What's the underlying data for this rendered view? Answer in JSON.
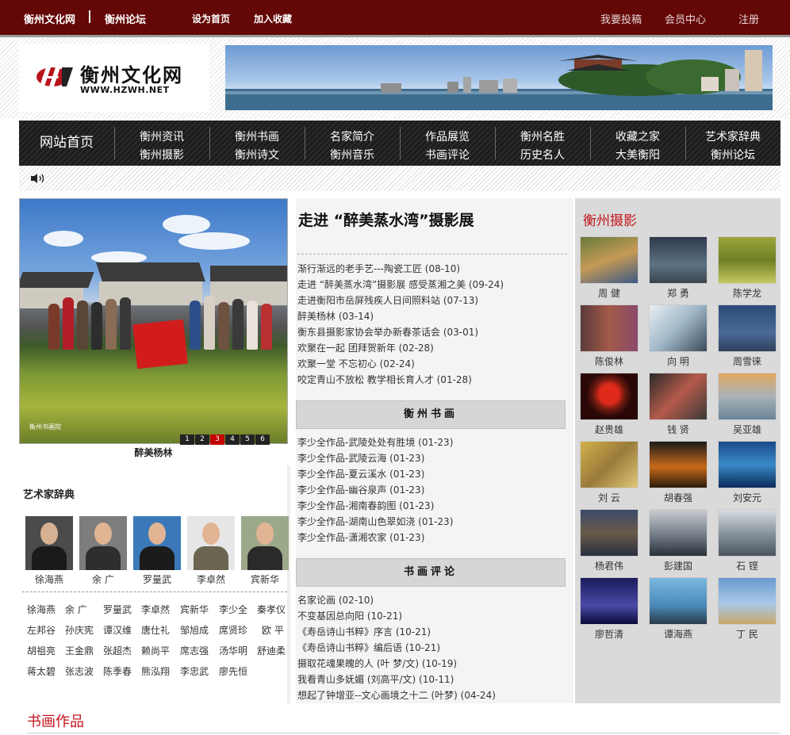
{
  "topbar": {
    "site_name": "衡州文化网",
    "forum": "衡州论坛",
    "set_home": "设为首页",
    "add_fav": "加入收藏",
    "submit": "我要投稿",
    "member": "会员中心",
    "register": "注册"
  },
  "logo": {
    "brand": "衡州文化网",
    "url": "WWW.HZWH.NET"
  },
  "nav": {
    "home": "网站首页",
    "columns": [
      {
        "a": "衡州资讯",
        "b": "衡州摄影"
      },
      {
        "a": "衡州书画",
        "b": "衡州诗文"
      },
      {
        "a": "名家简介",
        "b": "衡州音乐"
      },
      {
        "a": "作品展览",
        "b": "书画评论"
      },
      {
        "a": "衡州名胜",
        "b": "历史名人"
      },
      {
        "a": "收藏之家",
        "b": "大美衡阳"
      },
      {
        "a": "艺术家辞典",
        "b": "衡州论坛"
      }
    ]
  },
  "slideshow": {
    "caption": "醉美杨林",
    "credit": "衡州书画院",
    "pages": [
      "1",
      "2",
      "3",
      "4",
      "5",
      "6"
    ],
    "active_page": "3"
  },
  "artists": {
    "title": "艺术家辞典",
    "featured": [
      "徐海燕",
      "余 广",
      "罗量武",
      "李卓然",
      "宾新华"
    ],
    "names": [
      [
        "徐海燕",
        "余 广",
        "罗量武",
        "李卓然",
        "宾新华",
        "李少全",
        "秦孝仪"
      ],
      [
        "左邦谷",
        "孙庆宪",
        "谭汉维",
        "唐仕礼",
        "邹旭成",
        "席贤珍",
        "欧 平"
      ],
      [
        "胡祖亮",
        "王金鼎",
        "张超杰",
        "赖尚平",
        "席志强",
        "汤华明",
        "舒迪柔"
      ],
      [
        "蒋太碧",
        "张志波",
        "陈季春",
        "熊泓翔",
        "李忠武",
        "廖先恒"
      ]
    ]
  },
  "news": {
    "headline": "走进 “醉美蒸水湾”摄影展",
    "items": [
      "渐行渐远的老手艺---陶瓷工匠 (08-10)",
      "走进 “醉美蒸水湾”摄影展 感受蒸湘之美 (09-24)",
      "走进衡阳市岳屏残疾人日间照料站 (07-13)",
      "醉美杨林 (03-14)",
      "衡东县摄影家协会举办新春茶话会 (03-01)",
      "欢聚在一起 团拜贺新年 (02-28)",
      "欢聚一堂 不忘初心 (02-24)",
      "咬定青山不放松 教学相长育人才 (01-28)"
    ]
  },
  "calligraphy": {
    "title": "衡州书画",
    "items": [
      "李少全作品-武陵处处有胜境 (01-23)",
      "李少全作品-武陵云海 (01-23)",
      "李少全作品-夏云溪水 (01-23)",
      "李少全作品-幽谷泉声 (01-23)",
      "李少全作品-湘南春韵图 (01-23)",
      " 李少全作品-湖南山色翠如浇 (01-23)",
      "李少全作品-潇湘农家 (01-23)"
    ]
  },
  "reviews": {
    "title": "书画评论",
    "items": [
      "名家论画 (02-10)",
      " 不变基因总向阳 (10-21)",
      "《寿岳诗山书粹》序言 (10-21)",
      "《寿岳诗山书粹》编后语 (10-21)",
      "摄取花魂果魄的人 (叶 梦/文) (10-19)",
      "我看青山多妩媚 (刘高平/文) (10-11)",
      "想起了钟增亚--文心画境之十二 (叶梦)  (04-24)"
    ]
  },
  "photography": {
    "title": "衡州摄影",
    "photographers": [
      "周 健",
      "郑 勇",
      "陈学龙",
      "陈俊林",
      "向 明",
      "周雪徕",
      "赵贵雄",
      "钱 贤",
      "吴亚雄",
      "刘 云",
      "胡春强",
      "刘安元",
      "杨君伟",
      "彭建国",
      "石 铿",
      "廖哲清",
      "谭海燕",
      "丁 民"
    ]
  },
  "bottom": {
    "title": "书画作品"
  }
}
